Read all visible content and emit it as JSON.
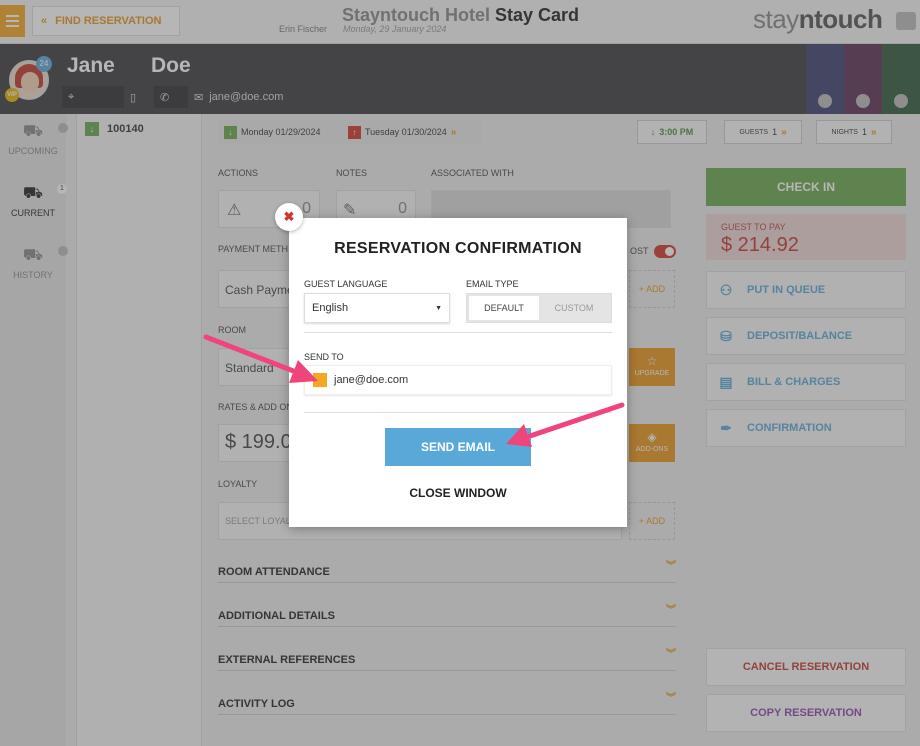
{
  "header": {
    "find_reservation": "FIND RESERVATION",
    "hotel_name": "Stayntouch Hotel",
    "page_title": "Stay Card",
    "user_name": "Erin Fischer",
    "business_date": "Monday, 29 January 2024",
    "logo_prefix": "stay",
    "logo_n": "n",
    "logo_suffix": "touch"
  },
  "guest": {
    "first_name": "Jane",
    "last_name": "Doe",
    "stay_count": "24",
    "vip": "VIP",
    "email": "jane@doe.com"
  },
  "left_rail": {
    "upcoming": "UPCOMING",
    "current": "CURRENT",
    "current_count": "1",
    "history": "HISTORY"
  },
  "reservation_list": {
    "number": "100140"
  },
  "dates": {
    "arrival": "Monday 01/29/2024",
    "departure": "Tuesday 01/30/2024",
    "time": "3:00 PM",
    "guests_label": "GUESTS",
    "guests": "1",
    "nights_label": "NIGHTS",
    "nights": "1"
  },
  "main": {
    "actions_label": "ACTIONS",
    "actions_count": "0",
    "notes_label": "NOTES",
    "notes_count": "0",
    "associated_label": "ASSOCIATED WITH",
    "payment_label": "PAYMENT METH",
    "payment_value": "Cash Payme",
    "post_label": "OST",
    "add_label": "+ ADD",
    "room_label": "ROOM",
    "room_value": "Standard",
    "upgrade_label": "UPGRADE",
    "rates_label": "RATES & ADD ON",
    "rate_value": "$ 199.0",
    "addons_label": "ADD-ONS",
    "loyalty_label": "LOYALTY",
    "loyalty_placeholder": "SELECT LOYAL",
    "loyalty_add": "+ ADD",
    "accordions": [
      "ROOM ATTENDANCE",
      "ADDITIONAL DETAILS",
      "EXTERNAL REFERENCES",
      "ACTIVITY LOG"
    ]
  },
  "right": {
    "check_in": "CHECK IN",
    "guest_to_pay_label": "GUEST TO PAY",
    "guest_to_pay": "$ 214.92",
    "put_in_queue": "PUT IN QUEUE",
    "deposit_balance": "DEPOSIT/BALANCE",
    "bill_charges": "BILL & CHARGES",
    "confirmation": "CONFIRMATION",
    "cancel_reservation": "CANCEL RESERVATION",
    "copy_reservation": "COPY RESERVATION"
  },
  "modal": {
    "title": "RESERVATION CONFIRMATION",
    "guest_language_label": "GUEST LANGUAGE",
    "guest_language": "English",
    "email_type_label": "EMAIL TYPE",
    "email_type_default": "DEFAULT",
    "email_type_custom": "CUSTOM",
    "send_to_label": "SEND TO",
    "send_to_email": "jane@doe.com",
    "send_email": "SEND EMAIL",
    "close_window": "CLOSE WINDOW"
  },
  "colors": {
    "accent_orange": "#e8941a",
    "checkin_green": "#6aa84f",
    "send_blue": "#5aa8d8",
    "annotation_pink": "#f0457c"
  }
}
